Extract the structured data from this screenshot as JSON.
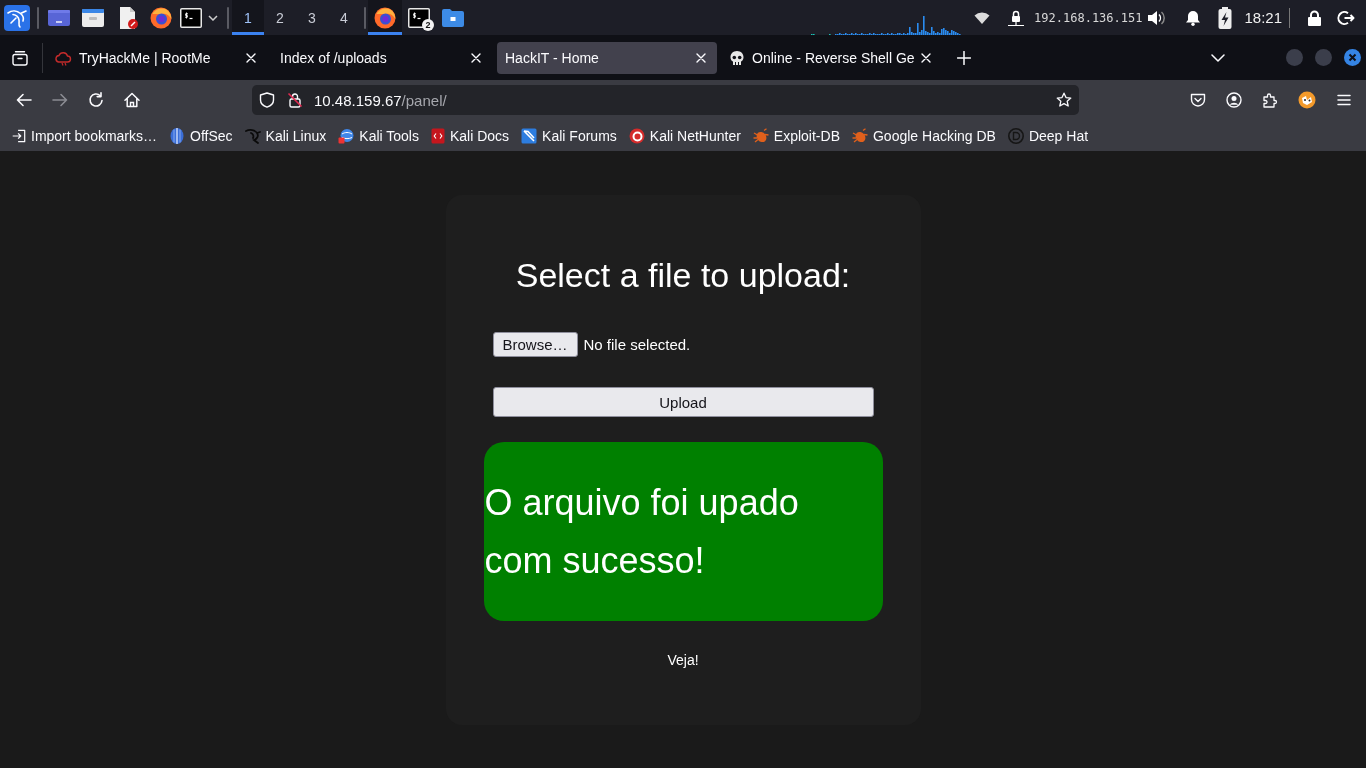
{
  "taskbar": {
    "workspaces": [
      {
        "label": "1",
        "selected": true
      },
      {
        "label": "2",
        "selected": false
      },
      {
        "label": "3",
        "selected": false
      },
      {
        "label": "4",
        "selected": false
      }
    ],
    "running_apps": [
      {
        "kind": "browser",
        "selected": true
      },
      {
        "kind": "terminal",
        "selected": false,
        "badge": "2"
      },
      {
        "kind": "folder",
        "selected": false
      }
    ],
    "ip_address": "192.168.136.151",
    "clock": "18:21"
  },
  "tabs": [
    {
      "title": "TryHackMe | RootMe",
      "kind": "cloud",
      "selected": false
    },
    {
      "title": "Index of /uploads",
      "kind": "plain",
      "selected": false
    },
    {
      "title": "HackIT - Home",
      "kind": "plain",
      "selected": true
    },
    {
      "title": "Online - Reverse Shell Ge",
      "kind": "skull",
      "selected": false
    }
  ],
  "toolbar": {
    "nav_buttons": [
      {
        "kind": "back",
        "disabled": false
      },
      {
        "kind": "forward",
        "disabled": true
      },
      {
        "kind": "reload",
        "disabled": false
      },
      {
        "kind": "home",
        "disabled": false
      }
    ],
    "url": {
      "host": "10.48.159.67",
      "path": "/panel/"
    }
  },
  "bookmarks": [
    {
      "label": "Import bookmarks…",
      "kind": "import"
    },
    {
      "label": "OffSec",
      "kind": "offsec"
    },
    {
      "label": "Kali Linux",
      "kind": "dragon"
    },
    {
      "label": "Kali Tools",
      "kind": "tools"
    },
    {
      "label": "Kali Docs",
      "kind": "docs"
    },
    {
      "label": "Kali Forums",
      "kind": "forums"
    },
    {
      "label": "Kali NetHunter",
      "kind": "nethunter"
    },
    {
      "label": "Exploit-DB",
      "kind": "bug"
    },
    {
      "label": "Google Hacking DB",
      "kind": "bug"
    },
    {
      "label": "Deep Hat",
      "kind": "hat"
    }
  ],
  "page": {
    "heading": "Select a file to upload:",
    "browse_button": "Browse…",
    "file_status": "No file selected.",
    "upload_button": "Upload",
    "message": "O arquivo foi upado com sucesso!",
    "link": "Veja!"
  }
}
